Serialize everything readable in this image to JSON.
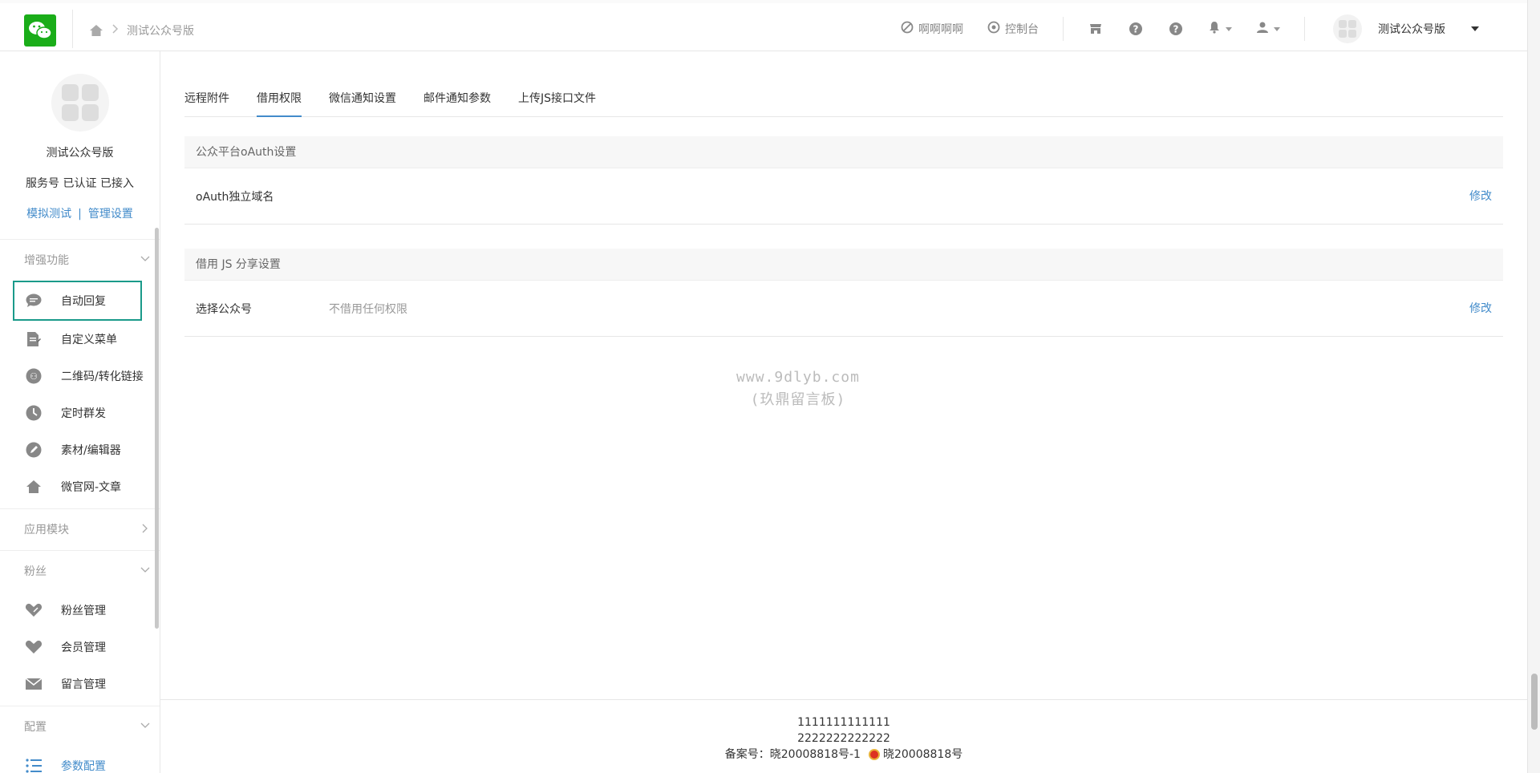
{
  "header": {
    "breadcrumb": [
      "测试公众号版"
    ],
    "links": [
      {
        "label": "啊啊啊啊",
        "icon": "ban-icon"
      },
      {
        "label": "控制台",
        "icon": "dashboard-icon"
      }
    ],
    "account_name": "测试公众号版"
  },
  "sidebar": {
    "account_name": "测试公众号版",
    "account_tags": "服务号 已认证 已接入",
    "link_simulate": "模拟测试",
    "link_manage": "管理设置",
    "groups": [
      {
        "label": "增强功能",
        "items": [
          {
            "label": "自动回复",
            "icon": "chat-bubble-icon"
          },
          {
            "label": "自定义菜单",
            "icon": "edit-doc-icon"
          },
          {
            "label": "二维码/转化链接",
            "icon": "qrcode-icon"
          },
          {
            "label": "定时群发",
            "icon": "clock-icon"
          },
          {
            "label": "素材/编辑器",
            "icon": "pencil-icon"
          },
          {
            "label": "微官网-文章",
            "icon": "home-icon"
          }
        ]
      },
      {
        "label": "应用模块",
        "items": []
      },
      {
        "label": "粉丝",
        "items": [
          {
            "label": "粉丝管理",
            "icon": "heart-outline-icon"
          },
          {
            "label": "会员管理",
            "icon": "heart-icon"
          },
          {
            "label": "留言管理",
            "icon": "mail-icon"
          }
        ]
      },
      {
        "label": "配置",
        "items": [
          {
            "label": "参数配置",
            "icon": "list-icon"
          }
        ]
      }
    ]
  },
  "main": {
    "tabs": [
      "远程附件",
      "借用权限",
      "微信通知设置",
      "邮件通知参数",
      "上传JS接口文件"
    ],
    "active_tab": "借用权限",
    "panels": [
      {
        "title": "公众平台oAuth设置",
        "row_label": "oAuth独立域名",
        "row_value": "",
        "action": "修改"
      },
      {
        "title": "借用 JS 分享设置",
        "row_label": "选择公众号",
        "row_value": "不借用任何权限",
        "action": "修改"
      }
    ],
    "watermark_line1": "www.9dlyb.com",
    "watermark_line2": "(玖鼎留言板)"
  },
  "footer": {
    "line1": "1111111111111",
    "line2": "2222222222222",
    "beian1": "备案号：晓20008818号-1",
    "beian2": "晓20008818号"
  },
  "colors": {
    "accent": "#428bca",
    "brand": "#1aad19",
    "highlight_box": "#1a9a8a"
  }
}
